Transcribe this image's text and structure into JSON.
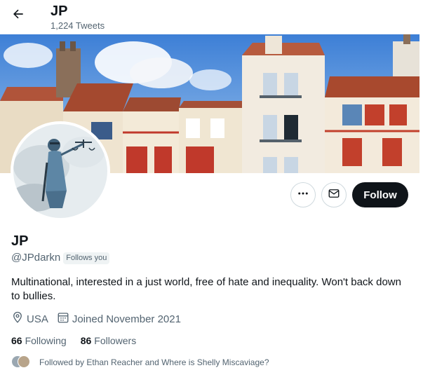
{
  "header": {
    "title": "JP",
    "tweet_count": "1,224 Tweets"
  },
  "profile": {
    "name": "JP",
    "handle": "@JPdarkn",
    "follows_you_badge": "Follows you",
    "bio": "Multinational, interested in a just world, free of hate and inequality. Won't back down to bullies.",
    "location": "USA",
    "joined": "Joined November 2021",
    "following_count": "66",
    "following_label": "Following",
    "followers_count": "86",
    "followers_label": "Followers",
    "followed_by": "Followed by Ethan Reacher and Where is Shelly Miscaviage?"
  },
  "actions": {
    "follow_label": "Follow"
  },
  "icons": {
    "back": "arrow-left-icon",
    "more": "more-horizontal-icon",
    "message": "envelope-icon",
    "location": "map-pin-icon",
    "calendar": "calendar-icon"
  },
  "colors": {
    "text_primary": "#0f1419",
    "text_secondary": "#536471",
    "follow_button_bg": "#0f1419",
    "border": "#cfd9de"
  }
}
